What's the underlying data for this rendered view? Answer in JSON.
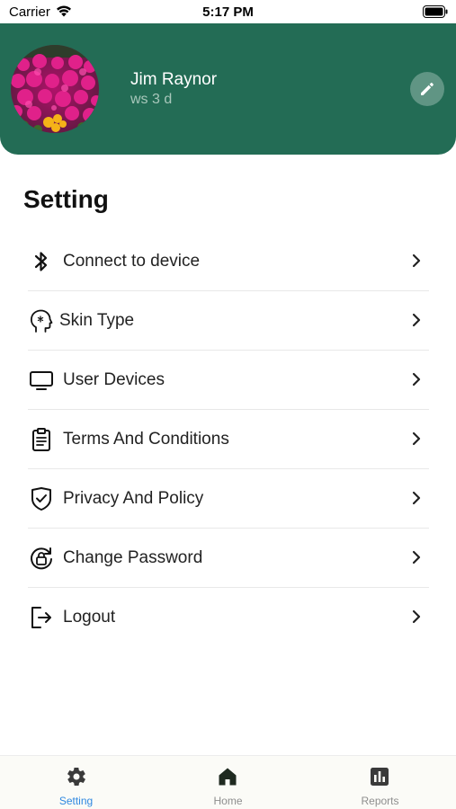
{
  "status_bar": {
    "carrier": "Carrier",
    "time": "5:17 PM"
  },
  "profile": {
    "name": "Jim Raynor",
    "subtitle": "ws 3 d",
    "header_color": "#236c55"
  },
  "page_title": "Setting",
  "menu": [
    {
      "label": "Connect to device",
      "icon": "bluetooth-icon"
    },
    {
      "label": "Skin Type",
      "icon": "face-icon"
    },
    {
      "label": "User Devices",
      "icon": "monitor-icon"
    },
    {
      "label": "Terms And Conditions",
      "icon": "clipboard-icon"
    },
    {
      "label": "Privacy And Policy",
      "icon": "shield-check-icon"
    },
    {
      "label": "Change Password",
      "icon": "lock-reset-icon"
    },
    {
      "label": "Logout",
      "icon": "logout-icon"
    }
  ],
  "tabs": [
    {
      "label": "Setting",
      "icon": "gear-icon",
      "active": true
    },
    {
      "label": "Home",
      "icon": "home-icon",
      "active": false
    },
    {
      "label": "Reports",
      "icon": "chart-icon",
      "active": false
    }
  ],
  "colors": {
    "accent": "#2f88e0",
    "tab_inactive": "#8e8e8e",
    "header": "#236c55"
  }
}
